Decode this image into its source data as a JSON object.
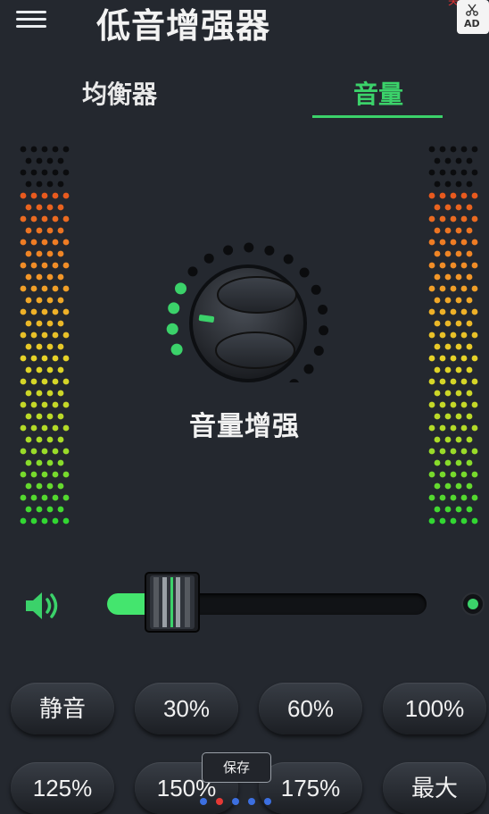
{
  "header": {
    "title": "低音增强器",
    "ad_label": "AD",
    "ad_close": "关闭"
  },
  "tabs": [
    {
      "label": "均衡器",
      "active": false
    },
    {
      "label": "音量",
      "active": true
    }
  ],
  "knob": {
    "label": "音量增强",
    "level_fraction": 0.2
  },
  "volume_slider": {
    "value_percent": 12
  },
  "preset_buttons": [
    {
      "label": "静音"
    },
    {
      "label": "30%"
    },
    {
      "label": "60%"
    },
    {
      "label": "100%"
    },
    {
      "label": "125%"
    },
    {
      "label": "150%"
    },
    {
      "label": "175%"
    },
    {
      "label": "最大"
    }
  ],
  "toast": {
    "text": "保存"
  },
  "pager": {
    "count": 5,
    "active_index": 1
  },
  "colors": {
    "accent": "#3bd26a",
    "background": "#24282f"
  }
}
